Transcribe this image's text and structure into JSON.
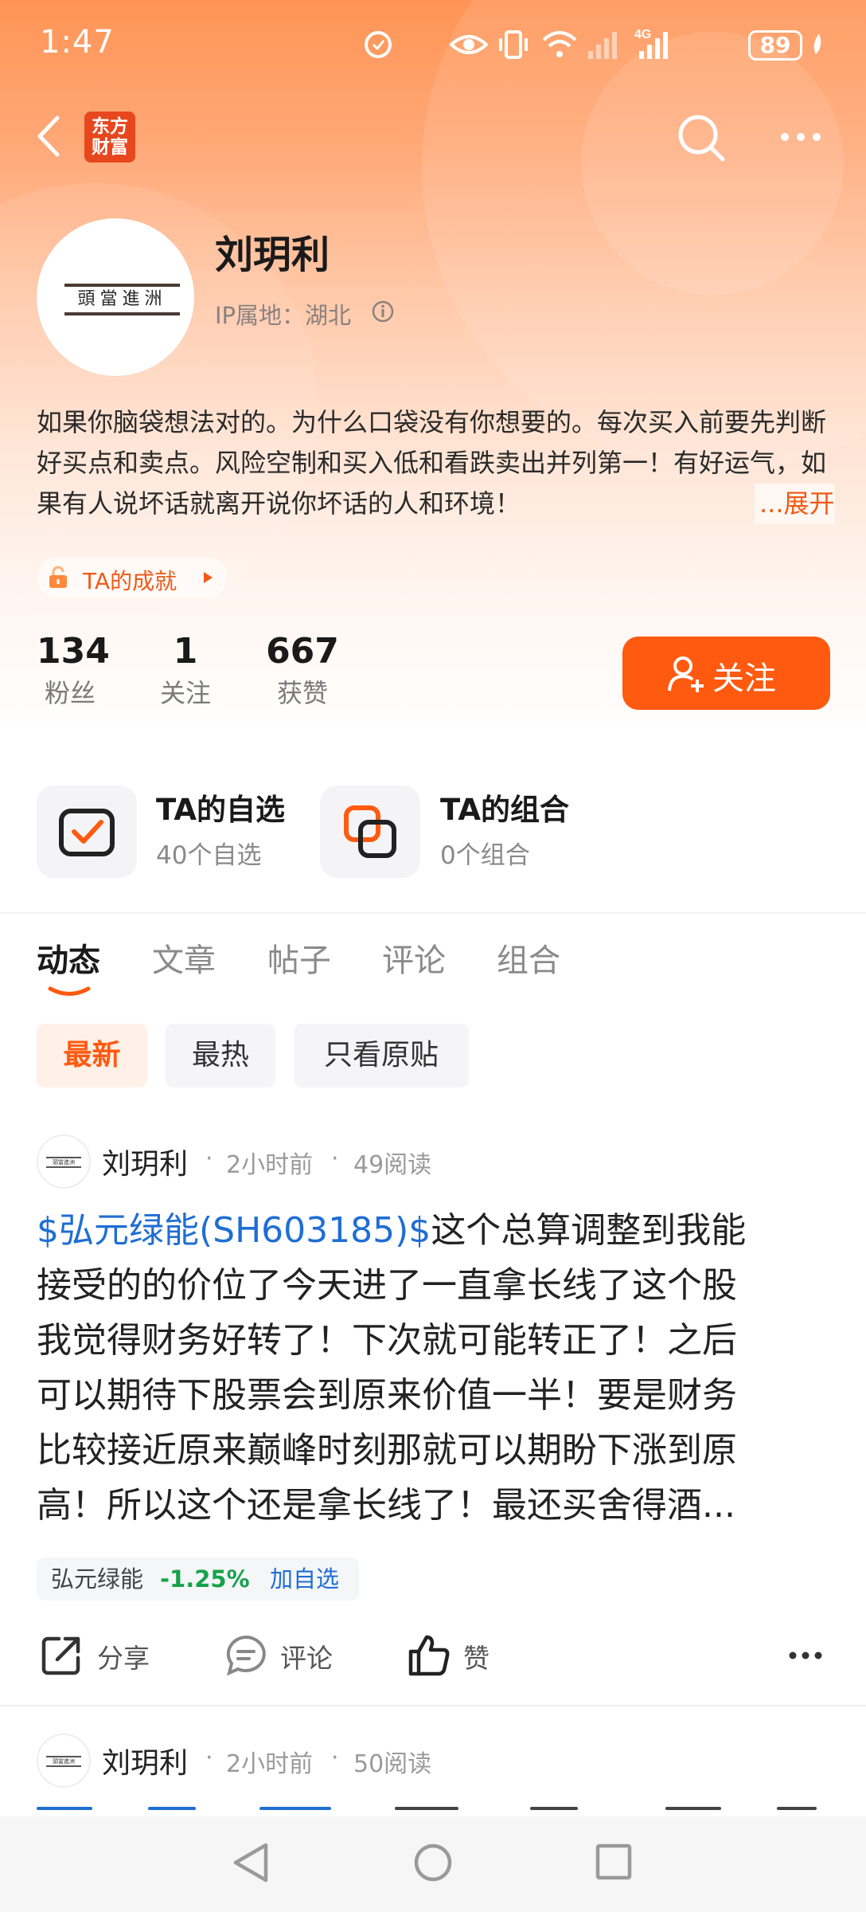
{
  "status_bar": {
    "time": "1:47",
    "battery": "89"
  },
  "nav": {
    "logo_text_line1": "东方",
    "logo_text_line2": "财富"
  },
  "profile": {
    "avatar_text": "頭當進洲",
    "name": "刘玥利",
    "ip_location": "IP属地：湖北",
    "bio": "如果你脑袋想法对的。为什么口袋没有你想要的。每次买入前要先判断好买点和卖点。风险空制和买入低和看跌卖出并列第一！有好运气，如果有人说坏话就离开说你坏话的人和环境！",
    "bio_expand": "...展开",
    "achievement_label": "TA的成就",
    "stats": [
      {
        "value": "134",
        "label": "粉丝"
      },
      {
        "value": "1",
        "label": "关注"
      },
      {
        "value": "667",
        "label": "获赞"
      }
    ],
    "follow_button": "关注"
  },
  "shortcuts": [
    {
      "title": "TA的自选",
      "subtitle": "40个自选",
      "icon": "watchlist-check-icon"
    },
    {
      "title": "TA的组合",
      "subtitle": "0个组合",
      "icon": "portfolio-stack-icon"
    }
  ],
  "tabs": [
    {
      "label": "动态",
      "active": true
    },
    {
      "label": "文章",
      "active": false
    },
    {
      "label": "帖子",
      "active": false
    },
    {
      "label": "评论",
      "active": false
    },
    {
      "label": "组合",
      "active": false
    }
  ],
  "filters": [
    {
      "label": "最新",
      "active": true
    },
    {
      "label": "最热",
      "active": false
    },
    {
      "label": "只看原贴",
      "active": false
    }
  ],
  "posts": [
    {
      "author": "刘玥利",
      "time": "2小时前",
      "reads": "49阅读",
      "stock_tag": "$弘元绿能(SH603185)$",
      "body_lines": [
        "这个总算调整到我能",
        "接受的的价位了今天进了一直拿长线了这个股",
        "我觉得财务好转了！下次就可能转正了！之后",
        "可以期待下股票会到原来价值一半！要是财务",
        "比较接近原来巅峰时刻那就可以期盼下涨到原",
        "高！所以这个还是拿长线了！最还买舍得酒..."
      ],
      "quote": {
        "name": "弘元绿能",
        "change": "-1.25%",
        "add_label": "加自选"
      },
      "actions": {
        "share": "分享",
        "comment": "评论",
        "like": "赞"
      }
    },
    {
      "author": "刘玥利",
      "time": "2小时前",
      "reads": "50阅读"
    }
  ],
  "colors": {
    "accent": "#ff5a10",
    "link": "#1f6ed4",
    "down": "#16a34a"
  }
}
